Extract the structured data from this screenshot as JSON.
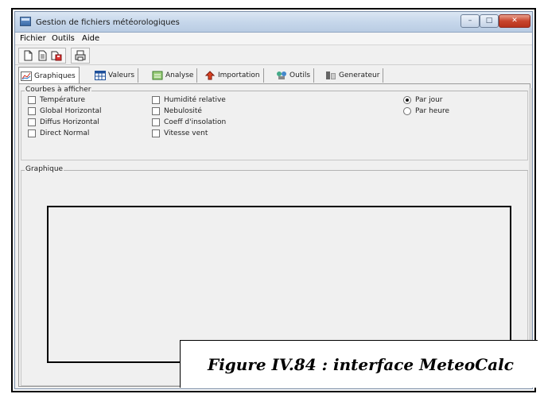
{
  "window": {
    "title": "Gestion de fichiers météorologiques",
    "buttons": {
      "minimize": "–",
      "maximize": "□",
      "close": "✕"
    }
  },
  "menu": [
    "Fichier",
    "Outils",
    "Aide"
  ],
  "toolbar": {
    "icons": [
      "new-file-icon",
      "open-file-icon",
      "save-file-icon",
      "print-icon"
    ]
  },
  "tabs": [
    {
      "label": "Graphiques",
      "icon": "chart-icon",
      "active": true
    },
    {
      "label": "Valeurs",
      "icon": "table-icon",
      "active": false
    },
    {
      "label": "Analyse",
      "icon": "analysis-icon",
      "active": false
    },
    {
      "label": "Importation",
      "icon": "import-icon",
      "active": false
    },
    {
      "label": "Outils",
      "icon": "tools-icon",
      "active": false
    },
    {
      "label": "Generateur",
      "icon": "generator-icon",
      "active": false
    }
  ],
  "curves": {
    "legend": "Courbes à afficher",
    "col1": [
      "Température",
      "Global Horizontal",
      "Diffus Horizontal",
      "Direct Normal"
    ],
    "col2": [
      "Humidité relative",
      "Nebulosité",
      "Coeff d'insolation",
      "Vitesse vent"
    ],
    "radios": [
      {
        "label": "Par jour",
        "checked": true
      },
      {
        "label": "Par heure",
        "checked": false
      }
    ]
  },
  "graph": {
    "legend": "Graphique"
  },
  "caption": "Figure IV.84 : interface MeteoCalc",
  "colors": {
    "accent": "#3a6ba8",
    "close": "#c8452d",
    "panel": "#f0f0f0"
  }
}
